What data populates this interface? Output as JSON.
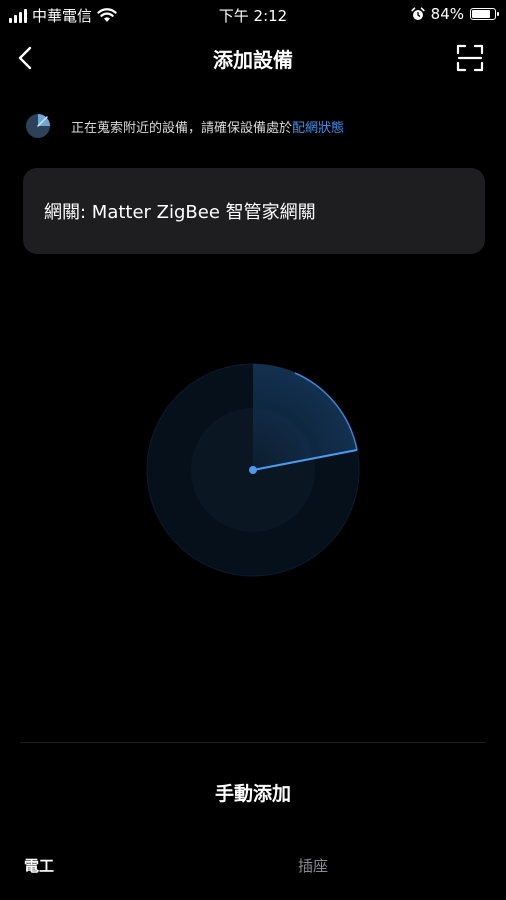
{
  "status_bar": {
    "carrier": "中華電信",
    "time": "下午 2:12",
    "battery_percent": "84%",
    "battery_level": 0.84,
    "icons": [
      "signal-icon",
      "wifi-icon",
      "alarm-icon",
      "battery-icon"
    ]
  },
  "nav": {
    "title": "添加設備",
    "back_icon": "chevron-left-icon",
    "scan_icon": "scan-icon"
  },
  "search_status": {
    "text": "正在蒐索附近的設備，請確保設備處於",
    "link": "配網狀態",
    "link_color": "#3d8ee8",
    "icon": "searching-spinner-icon"
  },
  "gateway": {
    "label": "網關: Matter ZigBee 智管家網關"
  },
  "radar": {
    "icon": "radar-scan-icon",
    "accent_color": "#3d8ee8"
  },
  "manual_add": {
    "label": "手動添加"
  },
  "tabs": [
    {
      "label": "電工",
      "active": true
    },
    {
      "label": "插座",
      "active": false
    }
  ]
}
